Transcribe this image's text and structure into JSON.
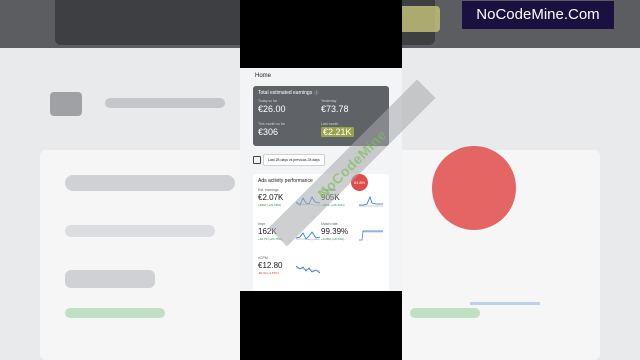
{
  "brand": {
    "label": "NoCodeMine.Com"
  },
  "watermark": {
    "text": "NoCodeMine"
  },
  "home": {
    "title": "Home"
  },
  "earnings": {
    "title": "Total estimated earnings",
    "info_icon": "info-icon",
    "today": {
      "label": "Today so far",
      "value": "€26.00"
    },
    "yesterday": {
      "label": "Yesterday",
      "value": "€73.78"
    },
    "month": {
      "label": "This month so far",
      "value": "€306"
    },
    "last_month": {
      "label": "Last month",
      "value": "€2.21K"
    }
  },
  "date_filter": {
    "label": "Last 28 days vs previous 28 days"
  },
  "ads_activity": {
    "title": "Ads activity performance",
    "badge": "84.8%",
    "metrics": [
      {
        "label": "Est. earnings",
        "value": "€2.07K",
        "delta": "+€367 (+21.56%)",
        "trend": "up"
      },
      {
        "label": "Requests",
        "value": "905K",
        "delta": "+189K (+26.42%)",
        "trend": "up"
      },
      {
        "label": "Impr.",
        "value": "162K",
        "delta": "+32.7K (+24.75%)",
        "trend": "up"
      },
      {
        "label": "Match rate",
        "value": "99.39%",
        "delta": "+0.28% (+0.14%)",
        "trend": "up"
      },
      {
        "label": "eCPM",
        "value": "€12.80",
        "delta": "-€0.34 (-2.57%)",
        "trend": "down"
      }
    ]
  },
  "colors": {
    "accent": "#1a73e8",
    "positive": "#1e8e3e",
    "negative": "#d93025",
    "badge": "#e24b4b",
    "card": "#5f6368"
  }
}
